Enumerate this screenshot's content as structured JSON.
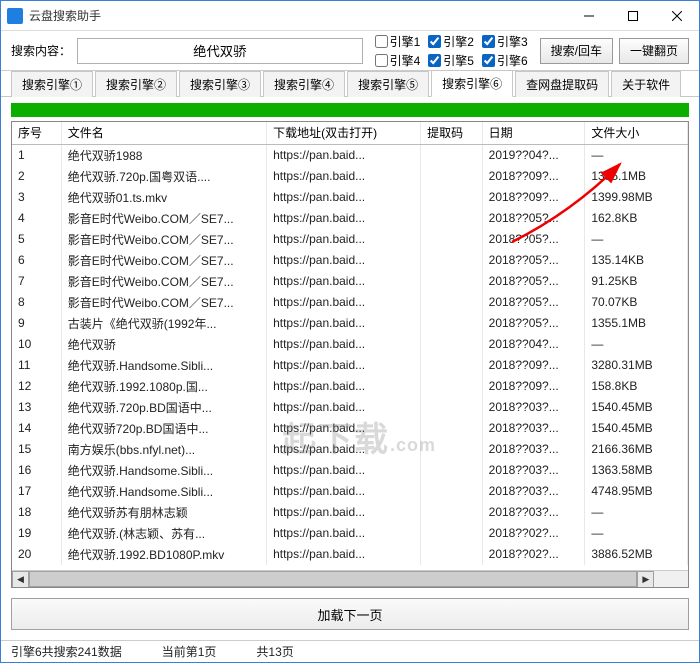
{
  "window": {
    "title": "云盘搜索助手"
  },
  "toolbar": {
    "search_label": "搜索内容：",
    "search_value": "绝代双骄",
    "btn_search": "搜索/回车",
    "btn_page": "一键翻页"
  },
  "engines": [
    {
      "label": "引擎1",
      "checked": false
    },
    {
      "label": "引擎2",
      "checked": true
    },
    {
      "label": "引擎3",
      "checked": true
    },
    {
      "label": "引擎4",
      "checked": false
    },
    {
      "label": "引擎5",
      "checked": true
    },
    {
      "label": "引擎6",
      "checked": true
    }
  ],
  "tabs": [
    {
      "label": "搜索引擎①"
    },
    {
      "label": "搜索引擎②"
    },
    {
      "label": "搜索引擎③"
    },
    {
      "label": "搜索引擎④"
    },
    {
      "label": "搜索引擎⑤"
    },
    {
      "label": "搜索引擎⑥",
      "active": true
    },
    {
      "label": "查网盘提取码"
    },
    {
      "label": "关于软件"
    }
  ],
  "columns": {
    "idx": "序号",
    "name": "文件名",
    "url": "下载地址(双击打开)",
    "code": "提取码",
    "date": "日期",
    "size": "文件大小"
  },
  "rows": [
    {
      "idx": "1",
      "name": "绝代双骄1988",
      "url": "https://pan.baid...",
      "code": "",
      "date": "2019??04?...",
      "size": "—"
    },
    {
      "idx": "2",
      "name": "绝代双骄.720p.国粤双语....",
      "url": "https://pan.baid...",
      "code": "",
      "date": "2018??09?...",
      "size": "1355.1MB"
    },
    {
      "idx": "3",
      "name": "绝代双骄01.ts.mkv",
      "url": "https://pan.baid...",
      "code": "",
      "date": "2018??09?...",
      "size": "1399.98MB"
    },
    {
      "idx": "4",
      "name": "影音E时代Weibo.COM／SE7...",
      "url": "https://pan.baid...",
      "code": "",
      "date": "2018??05?...",
      "size": "162.8KB"
    },
    {
      "idx": "5",
      "name": "影音E时代Weibo.COM／SE7...",
      "url": "https://pan.baid...",
      "code": "",
      "date": "2018??05?...",
      "size": "—"
    },
    {
      "idx": "6",
      "name": "影音E时代Weibo.COM／SE7...",
      "url": "https://pan.baid...",
      "code": "",
      "date": "2018??05?...",
      "size": "135.14KB"
    },
    {
      "idx": "7",
      "name": "影音E时代Weibo.COM／SE7...",
      "url": "https://pan.baid...",
      "code": "",
      "date": "2018??05?...",
      "size": "91.25KB"
    },
    {
      "idx": "8",
      "name": "影音E时代Weibo.COM／SE7...",
      "url": "https://pan.baid...",
      "code": "",
      "date": "2018??05?...",
      "size": "70.07KB"
    },
    {
      "idx": "9",
      "name": "古装片《绝代双骄(1992年...",
      "url": "https://pan.baid...",
      "code": "",
      "date": "2018??05?...",
      "size": "1355.1MB"
    },
    {
      "idx": "10",
      "name": "绝代双骄",
      "url": "https://pan.baid...",
      "code": "",
      "date": "2018??04?...",
      "size": "—"
    },
    {
      "idx": "11",
      "name": "绝代双骄.Handsome.Sibli...",
      "url": "https://pan.baid...",
      "code": "",
      "date": "2018??09?...",
      "size": "3280.31MB"
    },
    {
      "idx": "12",
      "name": "绝代双骄.1992.1080p.国...",
      "url": "https://pan.baid...",
      "code": "",
      "date": "2018??09?...",
      "size": "158.8KB"
    },
    {
      "idx": "13",
      "name": "绝代双骄.720p.BD国语中...",
      "url": "https://pan.baid...",
      "code": "",
      "date": "2018??03?...",
      "size": "1540.45MB"
    },
    {
      "idx": "14",
      "name": "绝代双骄720p.BD国语中...",
      "url": "https://pan.baid...",
      "code": "",
      "date": "2018??03?...",
      "size": "1540.45MB"
    },
    {
      "idx": "15",
      "name": "南方娱乐(bbs.nfyl.net)...",
      "url": "https://pan.baid...",
      "code": "",
      "date": "2018??03?...",
      "size": "2166.36MB"
    },
    {
      "idx": "16",
      "name": "绝代双骄.Handsome.Sibli...",
      "url": "https://pan.baid...",
      "code": "",
      "date": "2018??03?...",
      "size": "1363.58MB"
    },
    {
      "idx": "17",
      "name": "绝代双骄.Handsome.Sibli...",
      "url": "https://pan.baid...",
      "code": "",
      "date": "2018??03?...",
      "size": "4748.95MB"
    },
    {
      "idx": "18",
      "name": "绝代双骄苏有朋林志颖",
      "url": "https://pan.baid...",
      "code": "",
      "date": "2018??03?...",
      "size": "—"
    },
    {
      "idx": "19",
      "name": "绝代双骄.(林志颖、苏有...",
      "url": "https://pan.baid...",
      "code": "",
      "date": "2018??02?...",
      "size": "—"
    },
    {
      "idx": "20",
      "name": "绝代双骄.1992.BD1080P.mkv",
      "url": "https://pan.baid...",
      "code": "",
      "date": "2018??02?...",
      "size": "3886.52MB"
    }
  ],
  "loadmore": {
    "label": "加载下一页"
  },
  "status": {
    "count": "引擎6共搜索241数据",
    "page": "当前第1页",
    "total": "共13页"
  },
  "watermark": {
    "main": "起下载",
    "suffix": ".com"
  }
}
